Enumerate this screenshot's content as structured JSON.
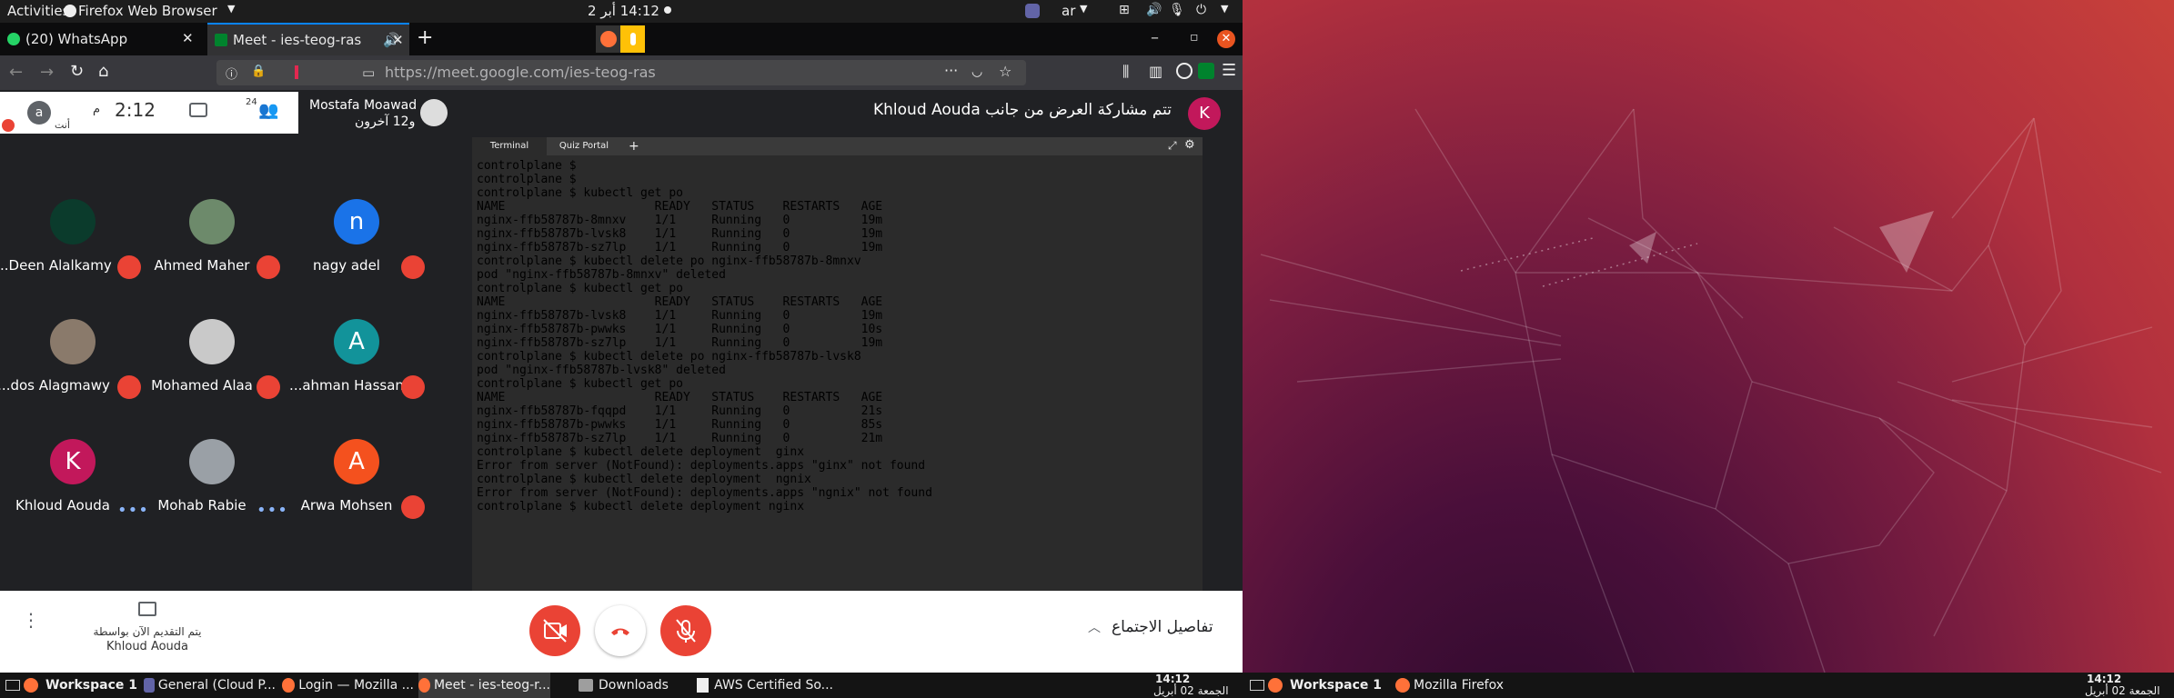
{
  "topbar": {
    "activities": "Activities",
    "app_menu": "Firefox Web Browser",
    "clock": "14:12  أبر 2",
    "lang": "ar"
  },
  "browser": {
    "tab1_title": "(20) WhatsApp",
    "tab2_title": "Meet - ies-teog-ras",
    "url": "https://meet.google.com/ies-teog-ras",
    "url_domain": "meet.google.com"
  },
  "meet": {
    "presenter_banner": "تتم مشاركة العرض من جانب Khloud Aouda",
    "presenter_initial": "K",
    "header_user_name": "Mostafa Moawad",
    "header_user_sub": "و12 آخرون",
    "time": "2:12",
    "time_suffix": "م",
    "you_label": "أنت",
    "you_initial": "a",
    "people_count": "24",
    "participants": [
      {
        "name": "...Deen Alalkamy",
        "initial": "",
        "muted": true
      },
      {
        "name": "Ahmed Maher",
        "initial": "",
        "muted": true
      },
      {
        "name": "nagy adel",
        "initial": "n",
        "muted": true
      },
      {
        "name": "...dos Alagmawy",
        "initial": "",
        "muted": true
      },
      {
        "name": "Mohamed Alaa",
        "initial": "",
        "muted": true
      },
      {
        "name": "...ahman Hassan",
        "initial": "A",
        "muted": true
      },
      {
        "name": "Khloud Aouda",
        "initial": "K",
        "muted": false
      },
      {
        "name": "Mohab Rabie",
        "initial": "",
        "muted": false
      },
      {
        "name": "Arwa Mohsen",
        "initial": "A",
        "muted": true
      }
    ],
    "terminal_tabs": [
      "Terminal",
      "Quiz Portal"
    ],
    "terminal_lines": [
      "controlplane $",
      "controlplane $",
      "controlplane $ kubectl get po",
      "NAME                     READY   STATUS    RESTARTS   AGE",
      "nginx-ffb58787b-8mnxv    1/1     Running   0          19m",
      "nginx-ffb58787b-lvsk8    1/1     Running   0          19m",
      "nginx-ffb58787b-sz7lp    1/1     Running   0          19m",
      "controlplane $ kubectl delete po nginx-ffb58787b-8mnxv",
      "pod \"nginx-ffb58787b-8mnxv\" deleted",
      "controlplane $ kubectl get po",
      "NAME                     READY   STATUS    RESTARTS   AGE",
      "nginx-ffb58787b-lvsk8    1/1     Running   0          19m",
      "nginx-ffb58787b-pwwks    1/1     Running   0          10s",
      "nginx-ffb58787b-sz7lp    1/1     Running   0          19m",
      "controlplane $ kubectl delete po nginx-ffb58787b-lvsk8",
      "pod \"nginx-ffb58787b-lvsk8\" deleted",
      "controlplane $ kubectl get po",
      "NAME                     READY   STATUS    RESTARTS   AGE",
      "nginx-ffb58787b-fqqpd    1/1     Running   0          21s",
      "nginx-ffb58787b-pwwks    1/1     Running   0          85s",
      "nginx-ffb58787b-sz7lp    1/1     Running   0          21m",
      "controlplane $ kubectl delete deployment  ginx",
      "Error from server (NotFound): deployments.apps \"ginx\" not found",
      "controlplane $ kubectl delete deployment  ngnix",
      "Error from server (NotFound): deployments.apps \"ngnix\" not found",
      "controlplane $ kubectl delete deployment nginx"
    ],
    "presenting_line1": "يتم التقديم الآن بواسطة",
    "presenting_line2": "Khloud Aouda",
    "meeting_details": "تفاصيل الاجتماع"
  },
  "taskbar_left": {
    "workspace": "Workspace 1",
    "items": [
      "General (Cloud P...",
      "Login — Mozilla ...",
      "Meet - ies-teog-r...",
      "Downloads",
      "AWS Certified So..."
    ],
    "clock_time": "14:12",
    "clock_date": "الجمعة 02 أبريل"
  },
  "taskbar_right": {
    "workspace": "Workspace 1",
    "items": [
      "Mozilla Firefox"
    ],
    "clock_time": "14:12",
    "clock_date": "الجمعة 02 أبريل"
  },
  "colors": {
    "meet_bg": "#202124",
    "mute_red": "#ea4335",
    "hangup_bg": "#3c4043",
    "avatar_pink": "#c2185b",
    "avatar_blue": "#1a73e8",
    "avatar_teal": "#12939a",
    "avatar_orange": "#f4511e"
  },
  "icons": [
    "whatsapp-icon",
    "meet-icon",
    "firefox-icon",
    "mic-icon",
    "mic-off-icon",
    "camera-off-icon",
    "hangup-icon",
    "present-icon",
    "chat-icon",
    "people-icon",
    "fullscreen-icon",
    "gear-icon",
    "more-vert-icon",
    "chevron-up-icon",
    "close-icon"
  ]
}
